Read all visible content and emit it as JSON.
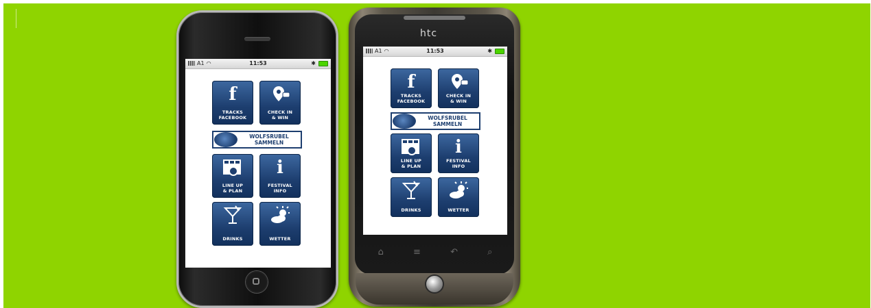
{
  "colors": {
    "background": "#8fd400",
    "tile": "#1d3e6f",
    "tile_light": "#3d68a0"
  },
  "status_bar": {
    "carrier": "A1",
    "time": "11:53"
  },
  "htc": {
    "brand": "htc"
  },
  "banner": {
    "line1": "WOLFSRUBEL",
    "line2": "SAMMELN"
  },
  "tiles": [
    {
      "icon": "facebook-f-icon",
      "line1": "TRACKS",
      "line2": "FACEBOOK"
    },
    {
      "icon": "map-pin-icon",
      "line1": "CHECK IN",
      "line2": "& WIN"
    },
    {
      "icon": "calendar-icon",
      "line1": "LINE UP",
      "line2": "& PLAN"
    },
    {
      "icon": "info-icon",
      "line1": "FESTIVAL",
      "line2": "INFO"
    },
    {
      "icon": "cocktail-icon",
      "line1": "DRINKS",
      "line2": ""
    },
    {
      "icon": "weather-icon",
      "line1": "WETTER",
      "line2": ""
    }
  ]
}
